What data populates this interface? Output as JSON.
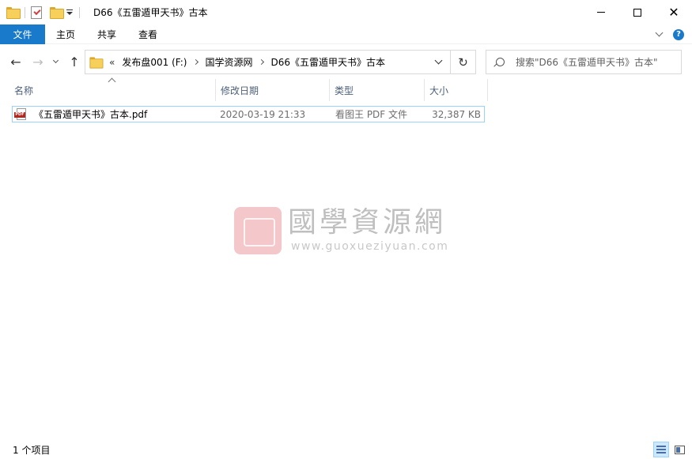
{
  "window": {
    "title": "D66《五雷遁甲天书》古本",
    "controls": {
      "minimize": "—",
      "maximize": "☐",
      "close": "✕"
    }
  },
  "ribbon": {
    "file_tab": "文件",
    "tabs": [
      "主页",
      "共享",
      "查看"
    ],
    "help": "?"
  },
  "address": {
    "more": "«",
    "crumbs": [
      "发布盘001 (F:)",
      "国学资源网",
      "D66《五雷遁甲天书》古本"
    ]
  },
  "search": {
    "placeholder": "搜索\"D66《五雷遁甲天书》古本\""
  },
  "columns": {
    "name": "名称",
    "date": "修改日期",
    "type": "类型",
    "size": "大小"
  },
  "files": [
    {
      "name": "《五雷遁甲天书》古本.pdf",
      "date": "2020-03-19 21:33",
      "type": "看图王 PDF 文件",
      "size": "32,387 KB",
      "icon": "pdf-file-icon"
    }
  ],
  "watermark": {
    "title": "國學資源網",
    "url": "www.guoxueziyuan.com"
  },
  "status": {
    "count": "1 个项目"
  }
}
